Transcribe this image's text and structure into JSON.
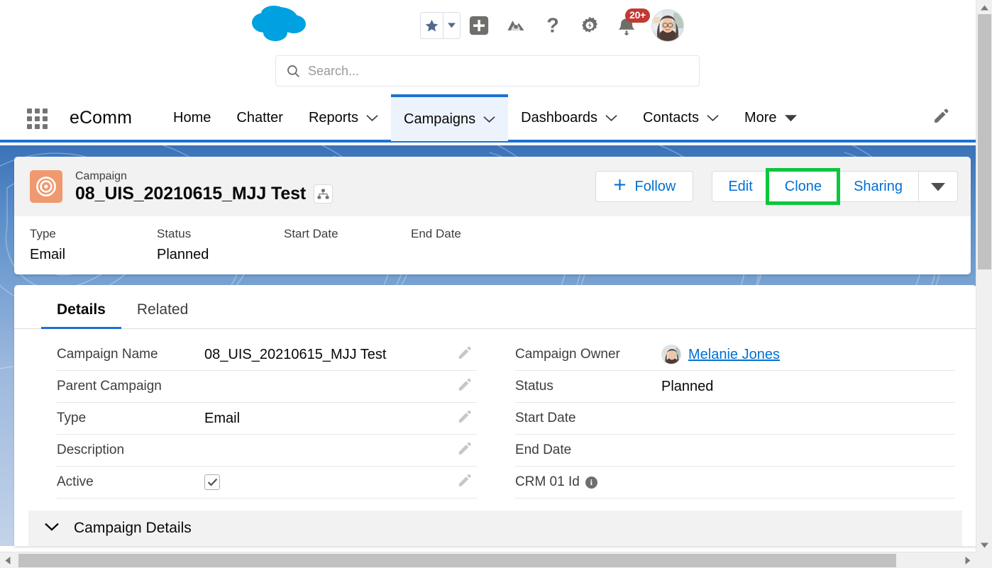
{
  "global_header": {
    "logo_name": "salesforce-cloud-logo",
    "actions": [
      {
        "name": "favorites-star",
        "icon": "star-icon"
      },
      {
        "name": "favorites-dropdown",
        "icon": "chevron-down-icon"
      },
      {
        "name": "global-create",
        "icon": "plus-square-icon"
      },
      {
        "name": "learning-adventure",
        "icon": "mountain-icon"
      },
      {
        "name": "help",
        "icon": "question-mark-icon"
      },
      {
        "name": "setup",
        "icon": "gear-icon"
      },
      {
        "name": "notifications",
        "icon": "bell-icon",
        "badge": "20+"
      },
      {
        "name": "user-profile",
        "icon": "avatar-icon"
      }
    ],
    "notification_badge": "20+"
  },
  "search": {
    "placeholder": "Search...",
    "icon": "search-icon"
  },
  "nav": {
    "app_name": "eComm",
    "app_launcher_icon": "app-launcher-grid-icon",
    "edit_icon": "pencil-icon",
    "items": [
      {
        "label": "Home",
        "has_caret": false,
        "active": false
      },
      {
        "label": "Chatter",
        "has_caret": false,
        "active": false
      },
      {
        "label": "Reports",
        "has_caret": true,
        "active": false
      },
      {
        "label": "Campaigns",
        "has_caret": true,
        "active": true
      },
      {
        "label": "Dashboards",
        "has_caret": true,
        "active": false
      },
      {
        "label": "Contacts",
        "has_caret": true,
        "active": false
      },
      {
        "label": "More",
        "has_caret": true,
        "active": false
      }
    ]
  },
  "highlights": {
    "object_label": "Campaign",
    "record_name": "08_UIS_20210615_MJJ Test",
    "record_icon": "campaign-target-icon",
    "hierarchy_icon": "hierarchy-icon",
    "follow_label": "Follow",
    "follow_icon": "plus-icon",
    "buttons": [
      {
        "label": "Edit",
        "highlighted": false
      },
      {
        "label": "Clone",
        "highlighted": true
      },
      {
        "label": "Sharing",
        "highlighted": false
      }
    ],
    "more_actions_icon": "caret-down-icon",
    "highlight_color": "#0ac73d",
    "fields": [
      {
        "label": "Type",
        "value": "Email"
      },
      {
        "label": "Status",
        "value": "Planned"
      },
      {
        "label": "Start Date",
        "value": ""
      },
      {
        "label": "End Date",
        "value": ""
      }
    ]
  },
  "details": {
    "tabs": [
      {
        "label": "Details",
        "active": true
      },
      {
        "label": "Related",
        "active": false
      }
    ],
    "left_fields": [
      {
        "label": "Campaign Name",
        "value": "08_UIS_20210615_MJJ Test",
        "type": "text",
        "editable": true
      },
      {
        "label": "Parent Campaign",
        "value": "",
        "type": "text",
        "editable": true
      },
      {
        "label": "Type",
        "value": "Email",
        "type": "text",
        "editable": true
      },
      {
        "label": "Description",
        "value": "",
        "type": "text",
        "editable": true
      },
      {
        "label": "Active",
        "value": "",
        "type": "checkbox",
        "checked": true,
        "editable": true
      }
    ],
    "right_fields": [
      {
        "label": "Campaign Owner",
        "value": "Melanie Jones",
        "type": "owner",
        "editable": false
      },
      {
        "label": "Status",
        "value": "Planned",
        "type": "text",
        "editable": false
      },
      {
        "label": "Start Date",
        "value": "",
        "type": "text",
        "editable": false
      },
      {
        "label": "End Date",
        "value": "",
        "type": "text",
        "editable": false
      },
      {
        "label": "CRM 01 Id",
        "value": "",
        "type": "info",
        "editable": false
      }
    ],
    "edit_icon": "pencil-icon",
    "info_icon": "info-icon"
  },
  "section": {
    "title": "Campaign Details",
    "collapse_icon": "chevron-down-icon"
  },
  "scrollbars": {
    "vertical_icon_up": "triangle-up-icon",
    "vertical_icon_down": "triangle-down-icon",
    "horizontal_icon_left": "triangle-left-icon",
    "horizontal_icon_right": "triangle-right-icon"
  },
  "colors": {
    "brand_blue": "#1c72d2",
    "link_blue": "#0070d2",
    "highlight_green": "#0ac73d",
    "badge_red": "#c23934",
    "campaign_icon_orange": "#f0996e"
  }
}
